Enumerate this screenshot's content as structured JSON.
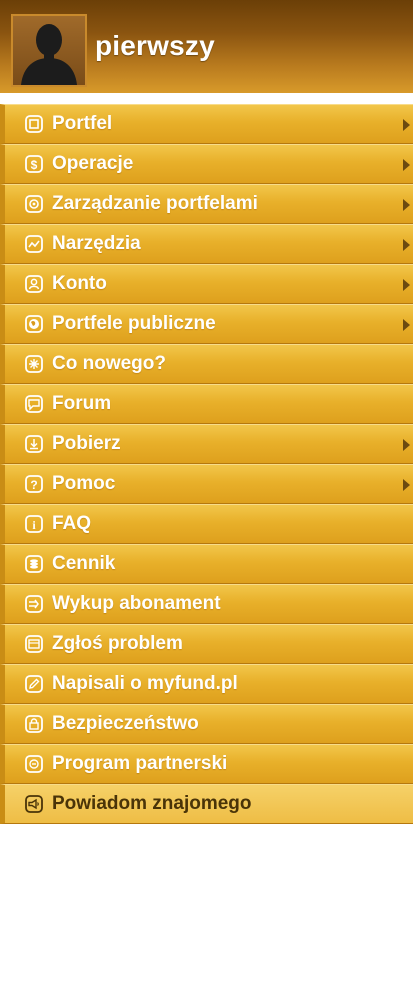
{
  "user": {
    "name": "pierwszy"
  },
  "colors": {
    "header": "#8a5410",
    "menu_item": "#e8b02a",
    "label": "#ffffff",
    "arrow": "#6b4a10"
  },
  "menu": [
    {
      "label": "Portfel",
      "icon": "portfolio-icon",
      "has_submenu": true
    },
    {
      "label": "Operacje",
      "icon": "dollar-icon",
      "has_submenu": true
    },
    {
      "label": "Zarządzanie portfelami",
      "icon": "settings-icon",
      "has_submenu": true
    },
    {
      "label": "Narzędzia",
      "icon": "chart-icon",
      "has_submenu": true
    },
    {
      "label": "Konto",
      "icon": "user-icon",
      "has_submenu": true
    },
    {
      "label": "Portfele publiczne",
      "icon": "globe-icon",
      "has_submenu": true
    },
    {
      "label": "Co nowego?",
      "icon": "sparkle-icon",
      "has_submenu": false
    },
    {
      "label": "Forum",
      "icon": "chat-icon",
      "has_submenu": false
    },
    {
      "label": "Pobierz",
      "icon": "download-icon",
      "has_submenu": true
    },
    {
      "label": "Pomoc",
      "icon": "help-icon",
      "has_submenu": true
    },
    {
      "label": "FAQ",
      "icon": "info-icon",
      "has_submenu": false
    },
    {
      "label": "Cennik",
      "icon": "coins-icon",
      "has_submenu": false
    },
    {
      "label": "Wykup abonament",
      "icon": "arrow-right-icon",
      "has_submenu": false
    },
    {
      "label": "Zgłoś problem",
      "icon": "report-icon",
      "has_submenu": false
    },
    {
      "label": "Napisali o myfund.pl",
      "icon": "pencil-icon",
      "has_submenu": false
    },
    {
      "label": "Bezpieczeństwo",
      "icon": "lock-icon",
      "has_submenu": false
    },
    {
      "label": "Program partnerski",
      "icon": "partner-icon",
      "has_submenu": false
    },
    {
      "label": "Powiadom znajomego",
      "icon": "megaphone-icon",
      "has_submenu": false
    }
  ]
}
